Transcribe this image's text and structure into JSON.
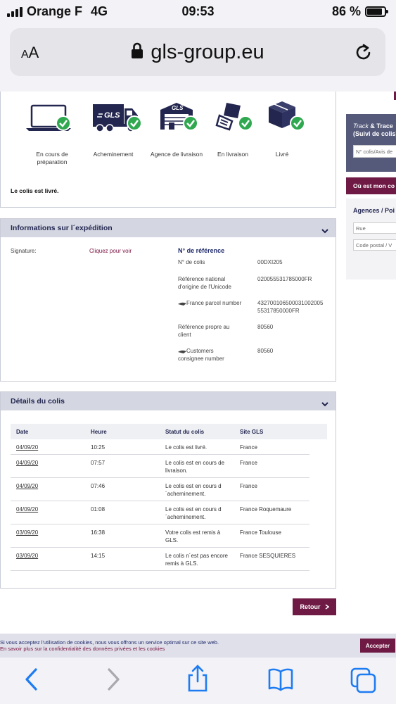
{
  "status_bar": {
    "carrier": "Orange F",
    "network": "4G",
    "time": "09:53",
    "battery": "86 %",
    "battery_level": 0.86
  },
  "browser": {
    "text_size_label": "AA",
    "url": "gls-group.eu"
  },
  "tracking": {
    "steps": [
      {
        "icon": "laptop-icon",
        "label": "En cours de préparation"
      },
      {
        "icon": "gls-truck-icon",
        "label": "Acheminement"
      },
      {
        "icon": "depot-icon",
        "label": "Agence de livraison"
      },
      {
        "icon": "hand-package-icon",
        "label": "En livraison"
      },
      {
        "icon": "box-icon",
        "label": "Livré"
      }
    ],
    "status_text": "Le colis est livré."
  },
  "shipment_info": {
    "title": "Informations sur l´expédition",
    "signature_label": "Signature:",
    "signature_link": "Cliquez pour voir",
    "ref_title": "N° de référence",
    "refs": [
      {
        "label": "N° de colis",
        "value": "00DXI205"
      },
      {
        "label": "Référence national d'origine de l'Unicode",
        "value": "020055531785000FR"
      },
      {
        "label": "France parcel number",
        "value": "432700106500031002005 55317850000FR"
      },
      {
        "label": "Référence propre au client",
        "value": "80560"
      },
      {
        "label": "Customers consignee number",
        "value": "80560"
      }
    ]
  },
  "parcel_details": {
    "title": "Détails du colis",
    "headers": [
      "Date",
      "Heure",
      "Statut du colis",
      "Site GLS"
    ],
    "rows": [
      {
        "date": "04/09/20",
        "time": "10:25",
        "status": "Le colis est livré.",
        "site": "France"
      },
      {
        "date": "04/09/20",
        "time": "07:57",
        "status": "Le colis est en cours de livraison.",
        "site": "France"
      },
      {
        "date": "04/09/20",
        "time": "07:46",
        "status": "Le colis est en cours d ´acheminement.",
        "site": "France"
      },
      {
        "date": "04/09/20",
        "time": "01:08",
        "status": "Le colis est en cours d ´acheminement.",
        "site": "France Roquemaure"
      },
      {
        "date": "03/09/20",
        "time": "16:38",
        "status": "Votre colis est remis à GLS.",
        "site": "France Toulouse"
      },
      {
        "date": "03/09/20",
        "time": "14:15",
        "status": "Le colis n´est pas encore remis à GLS.",
        "site": "France SESQUIERES"
      }
    ]
  },
  "retour_label": "Retour",
  "sidebar": {
    "track_title_1": "Track",
    "track_title_2": " & Trace",
    "track_subtitle": "(Suivi de colis)",
    "track_placeholder": "N° colis/Avis de",
    "where_label": "Où est mon co",
    "agencies_title": "Agences / Poi",
    "street_placeholder": "Rue",
    "postal_placeholder": "Code postal / V"
  },
  "cookie_banner": {
    "line1": "Si vous acceptez l'utilisation de cookies, nous vous offrons un service optimal sur ce site web.",
    "line2": "En savoir plus sur la confidentialité des données privées et les cookies",
    "accept_label": "Accepter"
  },
  "colors": {
    "accent": "#6e1a44",
    "header_band": "#d4d7e2",
    "navy": "#23264f",
    "check_green": "#2fa84f",
    "ios_blue": "#1e7cf2"
  }
}
